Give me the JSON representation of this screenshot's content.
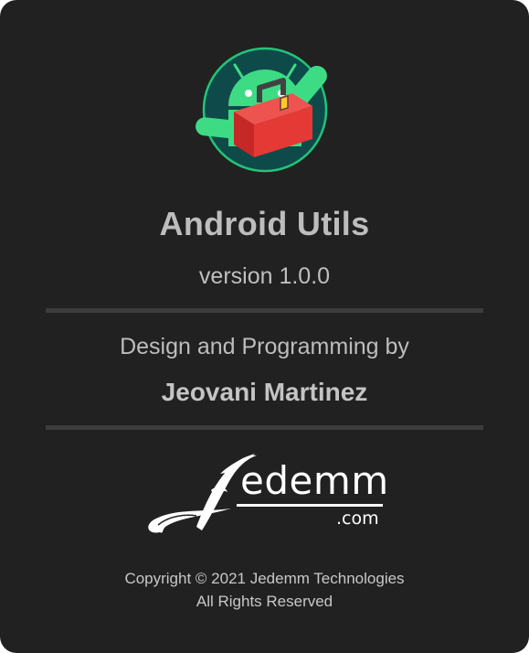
{
  "app": {
    "name": "Android Utils",
    "version": "version 1.0.0",
    "logo_icon": "android-toolbox-icon"
  },
  "credits": {
    "label": "Design and Programming by",
    "author": "Jeovani Martinez"
  },
  "brand": {
    "name": "edemm",
    "suffix": ".com",
    "logo_icon": "jedemm-j-swash-icon"
  },
  "footer": {
    "copyright": "Copyright © 2021 Jedemm Technologies",
    "rights": "All Rights Reserved"
  },
  "colors": {
    "background": "#212121",
    "logo_circle": "#0f4a4a",
    "logo_ring": "#22c47a",
    "android_green": "#3ddc84",
    "toolbox_red": "#e53935"
  }
}
